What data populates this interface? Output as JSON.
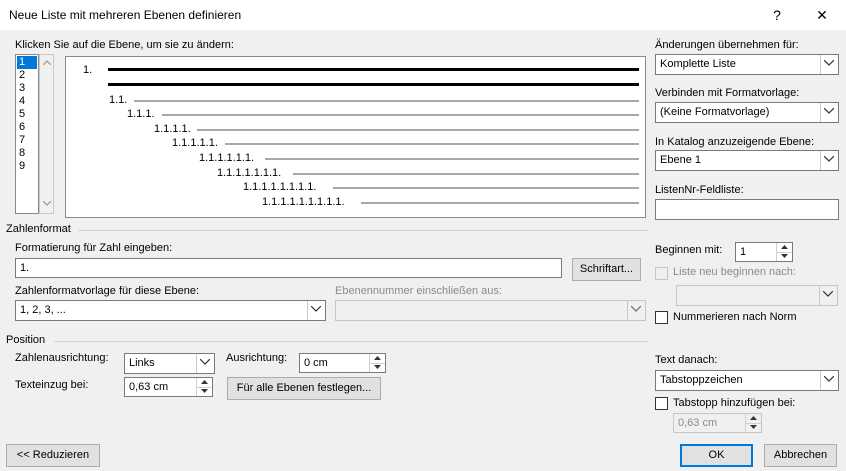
{
  "window": {
    "title": "Neue Liste mit mehreren Ebenen definieren",
    "help": "?",
    "close": "✕"
  },
  "levels": {
    "label": "Klicken Sie auf die Ebene, um sie zu ändern:",
    "items": [
      "1",
      "2",
      "3",
      "4",
      "5",
      "6",
      "7",
      "8",
      "9"
    ],
    "selected": "1"
  },
  "preview": {
    "labels": [
      "1.",
      "1.1.",
      "1.1.1.",
      "1.1.1.1.",
      "1.1.1.1.1.",
      "1.1.1.1.1.1.",
      "1.1.1.1.1.1.1.",
      "1.1.1.1.1.1.1.1.",
      "1.1.1.1.1.1.1.1.1."
    ]
  },
  "right": {
    "apply_label": "Änderungen übernehmen für:",
    "apply_value": "Komplette Liste",
    "style_label": "Verbinden mit Formatvorlage:",
    "style_value": "(Keine Formatvorlage)",
    "gallery_label": "In Katalog anzuzeigende Ebene:",
    "gallery_value": "Ebene 1",
    "listnum_label": "ListenNr-Feldliste:",
    "listnum_value": ""
  },
  "number_format": {
    "section": "Zahlenformat",
    "format_label": "Formatierung für Zahl eingeben:",
    "format_value": "1.",
    "font_button": "Schriftart...",
    "style_label": "Zahlenformatvorlage für diese Ebene:",
    "style_value": "1, 2, 3, ...",
    "include_label": "Ebenennummer einschließen aus:",
    "include_value": "",
    "start_label": "Beginnen mit:",
    "start_value": "1",
    "restart_label": "Liste neu beginnen nach:",
    "restart_value": "",
    "legal_label": "Nummerieren nach Norm"
  },
  "position": {
    "section": "Position",
    "align_label": "Zahlenausrichtung:",
    "align_value": "Links",
    "at_label": "Ausrichtung:",
    "at_value": "0 cm",
    "indent_label": "Texteinzug bei:",
    "indent_value": "0,63 cm",
    "set_all_button": "Für alle Ebenen festlegen...",
    "follow_label": "Text danach:",
    "follow_value": "Tabstoppzeichen",
    "tab_label": "Tabstopp hinzufügen bei:",
    "tab_value": "0,63 cm"
  },
  "footer": {
    "less_button": "<< Reduzieren",
    "ok_button": "OK",
    "cancel_button": "Abbrechen"
  }
}
